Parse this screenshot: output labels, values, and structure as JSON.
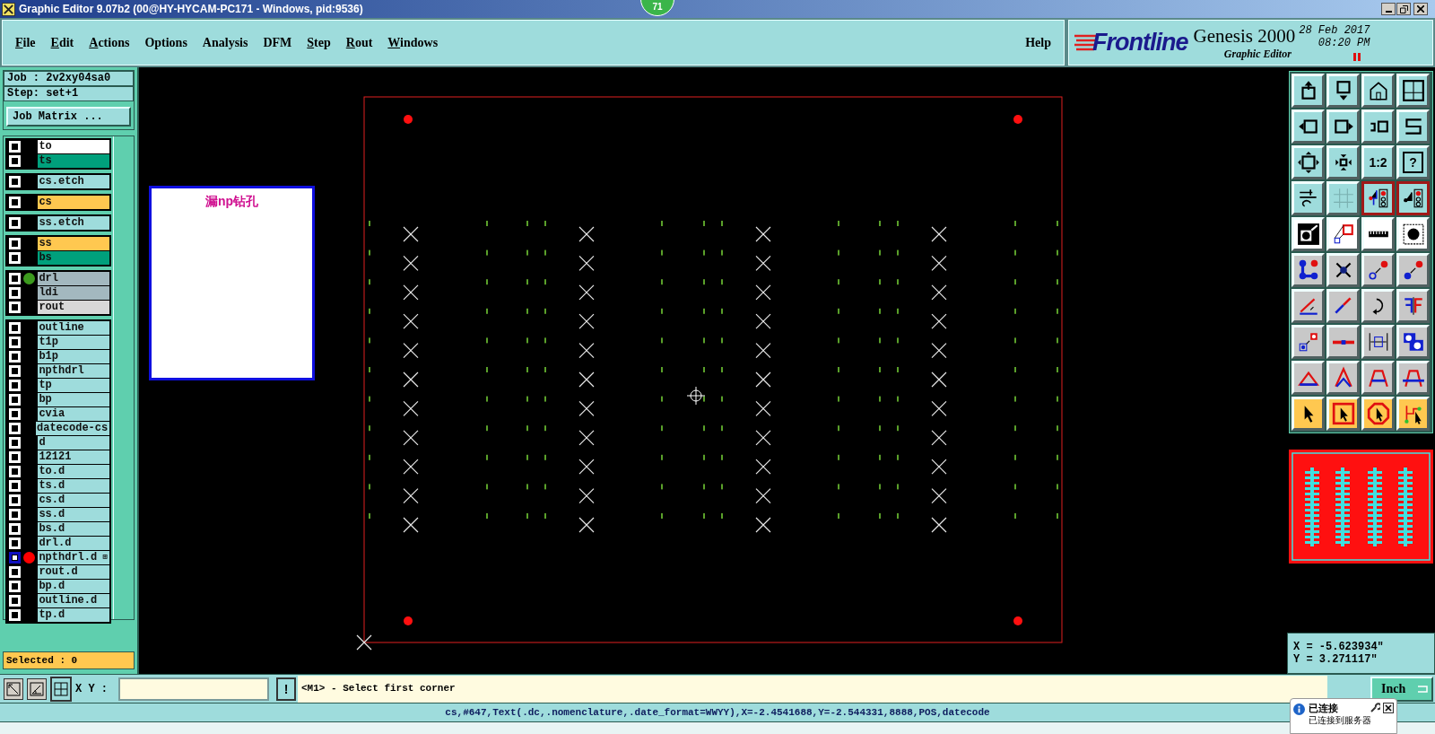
{
  "window": {
    "title": "Graphic Editor 9.07b2 (00@HY-HYCAM-PC171 - Windows, pid:9536)",
    "badge": "71"
  },
  "menu": [
    {
      "label": "File",
      "mnemonic": true
    },
    {
      "label": "Edit",
      "mnemonic": true
    },
    {
      "label": "Actions",
      "mnemonic": true
    },
    {
      "label": "Options",
      "mnemonic": false
    },
    {
      "label": "Analysis",
      "mnemonic": false
    },
    {
      "label": "DFM",
      "mnemonic": false
    },
    {
      "label": "Step",
      "mnemonic": true
    },
    {
      "label": "Rout",
      "mnemonic": true
    },
    {
      "label": "Windows",
      "mnemonic": true
    }
  ],
  "help_menu": {
    "label": "Help"
  },
  "brand": {
    "logo": "Frontline",
    "product": "Genesis 2000",
    "subtitle": "Graphic Editor",
    "date": "28 Feb 2017",
    "time": "08:20 PM"
  },
  "job": {
    "job": "Job : 2v2xy04sa0",
    "step": "Step: set+1",
    "matrix_button": "Job Matrix ..."
  },
  "layer_groups": [
    {
      "layers": [
        {
          "name": "to",
          "color": "#ffffff",
          "selected": false
        },
        {
          "name": "ts",
          "color": "#00a07c",
          "selected": false
        }
      ]
    },
    {
      "layers": [
        {
          "name": "cs.etch",
          "color": "#9edcdc",
          "selected": false
        }
      ]
    },
    {
      "layers": [
        {
          "name": "cs",
          "color": "#ffc850",
          "selected": false
        }
      ]
    },
    {
      "layers": [
        {
          "name": "ss.etch",
          "color": "#9edcdc",
          "selected": false
        }
      ]
    },
    {
      "layers": [
        {
          "name": "ss",
          "color": "#ffc850",
          "selected": false
        },
        {
          "name": "bs",
          "color": "#00a07c",
          "selected": false
        }
      ]
    },
    {
      "layers": [
        {
          "name": "drl",
          "color": "#a3b8bf",
          "selected": false,
          "marker": {
            "color": "#3c9a1e"
          }
        },
        {
          "name": "ldi",
          "color": "#a3b8bf",
          "selected": false
        },
        {
          "name": "rout",
          "color": "#d8d8d8",
          "selected": false
        }
      ]
    },
    {
      "layers": [
        {
          "name": "outline",
          "color": "#9edcdc",
          "selected": false
        },
        {
          "name": "t1p",
          "color": "#9edcdc",
          "selected": false
        },
        {
          "name": "b1p",
          "color": "#9edcdc",
          "selected": false
        },
        {
          "name": "npthdrl",
          "color": "#9edcdc",
          "selected": false
        },
        {
          "name": "tp",
          "color": "#9edcdc",
          "selected": false
        },
        {
          "name": "bp",
          "color": "#9edcdc",
          "selected": false
        },
        {
          "name": "cvia",
          "color": "#9edcdc",
          "selected": false
        },
        {
          "name": "datecode-cs",
          "color": "#9edcdc",
          "selected": false
        },
        {
          "name": "d",
          "color": "#9edcdc",
          "selected": false
        },
        {
          "name": "12121",
          "color": "#9edcdc",
          "selected": false
        },
        {
          "name": "to.d",
          "color": "#9edcdc",
          "selected": false
        },
        {
          "name": "ts.d",
          "color": "#9edcdc",
          "selected": false
        },
        {
          "name": "cs.d",
          "color": "#9edcdc",
          "selected": false
        },
        {
          "name": "ss.d",
          "color": "#9edcdc",
          "selected": false
        },
        {
          "name": "bs.d",
          "color": "#9edcdc",
          "selected": false
        },
        {
          "name": "drl.d",
          "color": "#9edcdc",
          "selected": false
        },
        {
          "name": "npthdrl.d",
          "color": "#9edcdc",
          "selected": true,
          "marker": {
            "color": "#ff0000"
          },
          "flag": "⊞"
        },
        {
          "name": "rout.d",
          "color": "#9edcdc",
          "selected": false
        },
        {
          "name": "bp.d",
          "color": "#9edcdc",
          "selected": false
        },
        {
          "name": "outline.d",
          "color": "#9edcdc",
          "selected": false
        },
        {
          "name": "tp.d",
          "color": "#9edcdc",
          "selected": false
        }
      ]
    }
  ],
  "selected_count": "Selected : 0",
  "popup": {
    "text": "漏np钻孔"
  },
  "toolbar_rows": [
    [
      {
        "kind": "view",
        "on": false
      },
      {
        "kind": "view",
        "on": false
      },
      {
        "kind": "view",
        "on": false
      },
      {
        "kind": "view",
        "on": false
      }
    ],
    [
      {
        "kind": "view",
        "on": false
      },
      {
        "kind": "view",
        "on": false
      },
      {
        "kind": "view",
        "on": false
      },
      {
        "kind": "view",
        "on": false
      }
    ],
    [
      {
        "kind": "view",
        "on": false
      },
      {
        "kind": "view",
        "on": false
      },
      {
        "kind": "view",
        "on": false,
        "label": "1:2"
      },
      {
        "kind": "view",
        "on": false,
        "label": "?"
      }
    ],
    [
      {
        "kind": "view",
        "on": false
      },
      {
        "kind": "view",
        "on": false
      },
      {
        "kind": "view",
        "on": true
      },
      {
        "kind": "view",
        "on": true
      }
    ],
    [
      {
        "kind": "mode",
        "on": false
      },
      {
        "kind": "mode",
        "on": false
      },
      {
        "kind": "mode",
        "on": false
      },
      {
        "kind": "mode",
        "on": false
      }
    ],
    [
      {
        "kind": "tool",
        "on": false
      },
      {
        "kind": "tool",
        "on": false
      },
      {
        "kind": "tool",
        "on": false
      },
      {
        "kind": "tool",
        "on": false
      }
    ],
    [
      {
        "kind": "tool",
        "on": false
      },
      {
        "kind": "tool",
        "on": false
      },
      {
        "kind": "tool",
        "on": false
      },
      {
        "kind": "tool",
        "on": false
      }
    ],
    [
      {
        "kind": "tool",
        "on": false
      },
      {
        "kind": "tool",
        "on": false
      },
      {
        "kind": "tool",
        "on": false
      },
      {
        "kind": "tool",
        "on": false
      }
    ],
    [
      {
        "kind": "tool",
        "on": false
      },
      {
        "kind": "tool",
        "on": false
      },
      {
        "kind": "tool",
        "on": false
      },
      {
        "kind": "tool",
        "on": false
      }
    ],
    [
      {
        "kind": "select",
        "on": false
      },
      {
        "kind": "select",
        "on": false
      },
      {
        "kind": "select",
        "on": false
      },
      {
        "kind": "select",
        "on": false
      }
    ]
  ],
  "coordinates": {
    "x": "X = -5.623934\"",
    "y": "Y = 3.271117\""
  },
  "command_bar": {
    "xy_label": "X Y :",
    "alert_button": "!",
    "prompt": "<M1> - Select first corner",
    "units": "Inch"
  },
  "status_line": "cs,#647,Text(.dc,.nomenclature,.date_format=WWYY),X=-2.4541688,Y=-2.544331,8888,POS,datecode",
  "notification": {
    "title": "已连接",
    "message": "已连接到服务器"
  }
}
